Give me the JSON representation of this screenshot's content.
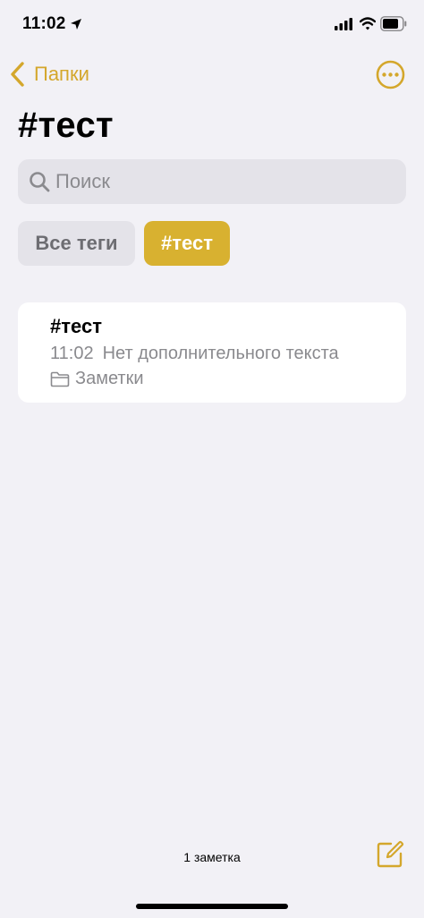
{
  "status_bar": {
    "time": "11:02"
  },
  "nav": {
    "back_label": "Папки"
  },
  "page": {
    "title": "#тест"
  },
  "search": {
    "placeholder": "Поиск"
  },
  "tags": {
    "all_label": "Все теги",
    "active_label": "#тест"
  },
  "notes": [
    {
      "title": "#тест",
      "time": "11:02",
      "preview": "Нет дополнительного текста",
      "folder": "Заметки"
    }
  ],
  "footer": {
    "count_label": "1 заметка"
  },
  "colors": {
    "accent": "#d4a72c",
    "active_chip": "#d8b130",
    "background": "#f2f1f6",
    "secondary_text": "#8a8a8e"
  },
  "icons": [
    "location-arrow-icon",
    "signal-icon",
    "wifi-icon",
    "battery-icon",
    "chevron-left-icon",
    "more-ellipsis-icon",
    "search-icon",
    "folder-icon",
    "compose-icon"
  ]
}
